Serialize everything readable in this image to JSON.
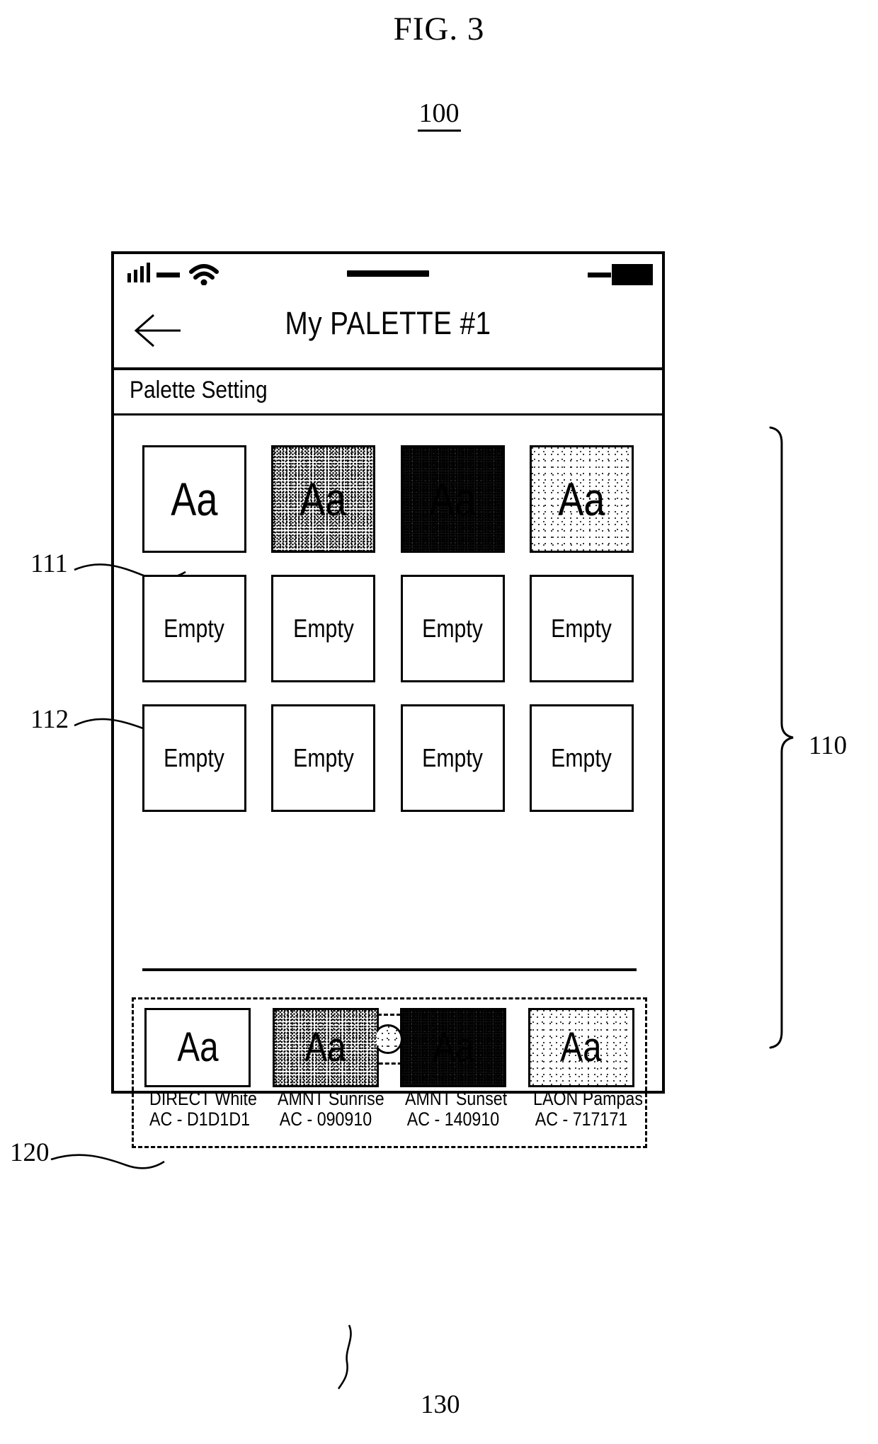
{
  "figure": {
    "title": "FIG. 3",
    "device_ref": "100"
  },
  "callouts": {
    "grid_ref": "110",
    "filled_cell_ref": "111",
    "empty_cell_ref": "112",
    "preset_strip_ref": "120",
    "page_indicator_ref": "130"
  },
  "phone": {
    "status_bar": {
      "signal_icon": "signal-bars-icon",
      "wifi_icon": "wifi-icon",
      "battery_icon": "battery-icon"
    },
    "title_bar": {
      "back_icon": "back-arrow-icon",
      "title": "My PALETTE #1"
    },
    "setting_row": {
      "label": "Palette Setting"
    }
  },
  "grid": {
    "rows": [
      [
        {
          "label": "Aa",
          "fill": "stipple-none",
          "type": "sample"
        },
        {
          "label": "Aa",
          "fill": "stipple-medium",
          "type": "sample"
        },
        {
          "label": "Aa",
          "fill": "stipple-dark",
          "type": "sample"
        },
        {
          "label": "Aa",
          "fill": "stipple-light",
          "type": "sample"
        }
      ],
      [
        {
          "label": "Empty",
          "fill": "stipple-none",
          "type": "empty"
        },
        {
          "label": "Empty",
          "fill": "stipple-none",
          "type": "empty"
        },
        {
          "label": "Empty",
          "fill": "stipple-none",
          "type": "empty"
        },
        {
          "label": "Empty",
          "fill": "stipple-none",
          "type": "empty"
        }
      ],
      [
        {
          "label": "Empty",
          "fill": "stipple-none",
          "type": "empty"
        },
        {
          "label": "Empty",
          "fill": "stipple-none",
          "type": "empty"
        },
        {
          "label": "Empty",
          "fill": "stipple-none",
          "type": "empty"
        },
        {
          "label": "Empty",
          "fill": "stipple-none",
          "type": "empty"
        }
      ]
    ]
  },
  "presets": [
    {
      "sample": "Aa",
      "name": "DIRECT White",
      "code": "AC - D1D1D1",
      "fill": "stipple-none"
    },
    {
      "sample": "Aa",
      "name": "AMNT Sunrise",
      "code": "AC - 090910",
      "fill": "stipple-medium"
    },
    {
      "sample": "Aa",
      "name": "AMNT Sunset",
      "code": "AC - 140910",
      "fill": "stipple-dark"
    },
    {
      "sample": "Aa",
      "name": "LAON Pampas",
      "code": "AC - 717171",
      "fill": "stipple-light"
    }
  ],
  "page_dots": [
    {
      "state": "active",
      "fill": "stipple-dark"
    },
    {
      "state": "inactive",
      "fill": "stipple-light"
    },
    {
      "state": "inactive",
      "fill": "stipple-light"
    }
  ]
}
